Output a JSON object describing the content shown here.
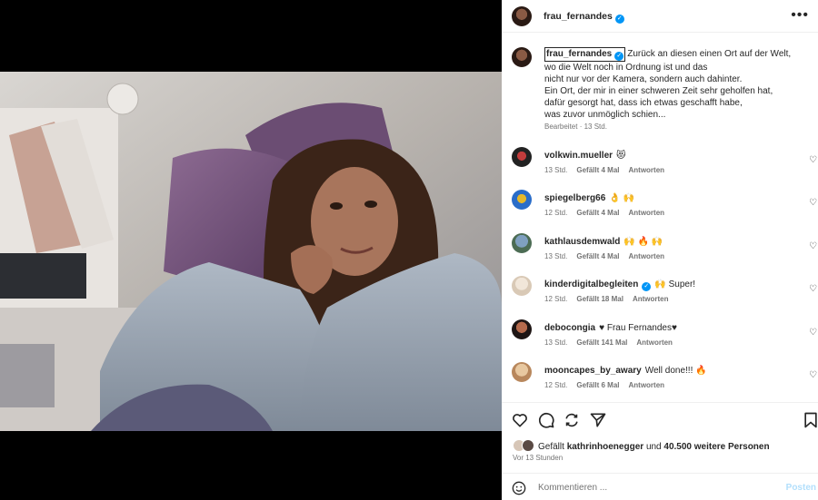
{
  "post": {
    "author": "frau_fernandes",
    "caption_lines": [
      "Zurück an diesen einen Ort auf der Welt,",
      "wo die Welt noch in Ordnung ist und das",
      "nicht nur vor der Kamera, sondern auch dahinter.",
      "Ein Ort, der mir in einer schweren Zeit sehr geholfen hat,",
      "dafür gesorgt hat, dass ich etwas geschafft habe,",
      "was zuvor unmöglich schien..."
    ],
    "caption_meta": "Bearbeitet · 13 Std.",
    "more_icon": "more-horizontal-icon"
  },
  "comments": [
    {
      "user": "volkwin.mueller",
      "text": "😻",
      "time": "13 Std.",
      "likes": "Gefällt 4 Mal",
      "reply": "Antworten"
    },
    {
      "user": "spiegelberg66",
      "text": "👌 🙌",
      "time": "12 Std.",
      "likes": "Gefällt 4 Mal",
      "reply": "Antworten"
    },
    {
      "user": "kathlausdemwald",
      "text": "🙌 🔥 🙌",
      "time": "13 Std.",
      "likes": "Gefällt 4 Mal",
      "reply": "Antworten"
    },
    {
      "user": "kinderdigitalbegleiten",
      "verified": true,
      "text": "🙌 Super!",
      "time": "12 Std.",
      "likes": "Gefällt 18 Mal",
      "reply": "Antworten"
    },
    {
      "user": "debocongia",
      "text": "♥ Frau Fernandes♥",
      "time": "13 Std.",
      "likes": "Gefällt 141 Mal",
      "reply": "Antworten"
    },
    {
      "user": "mooncapes_by_awary",
      "text": "Well done!!! 🔥",
      "time": "12 Std.",
      "likes": "Gefällt 6 Mal",
      "reply": "Antworten"
    }
  ],
  "likes": {
    "prefix": "Gefällt",
    "user": "kathrinhoenegger",
    "joiner": "und",
    "count": "40.500 weitere Personen"
  },
  "time_ago": "Vor 13 Stunden",
  "composer": {
    "placeholder": "Kommentieren ...",
    "post_label": "Posten"
  },
  "colors": {
    "verified": "#0095f6",
    "secondary_text": "#737373",
    "post_disabled": "#b2dffc"
  }
}
